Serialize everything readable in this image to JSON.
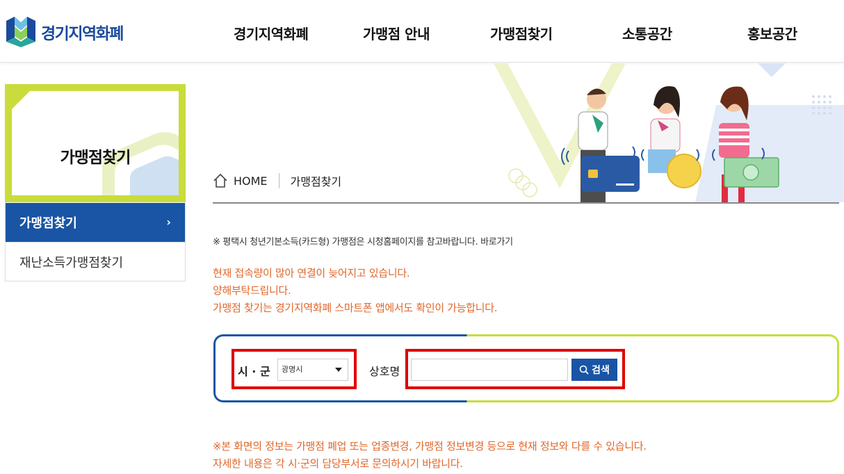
{
  "header": {
    "logo_text": "경기지역화폐",
    "nav": [
      "경기지역화폐",
      "가맹점 안내",
      "가맹점찾기",
      "소통공간",
      "홍보공간"
    ]
  },
  "sidebar": {
    "title": "가맹점찾기",
    "items": [
      {
        "label": "가맹점찾기",
        "active": true
      },
      {
        "label": "재난소득가맹점찾기",
        "active": false
      }
    ]
  },
  "breadcrumb": {
    "home": "HOME",
    "current": "가맹점찾기"
  },
  "notices": {
    "small": "※ 평택시 청년기본소득(카드형) 가맹점은 시청홈페이지를 참고바랍니다. 바로가기",
    "orange": [
      "현재 접속량이 많아 연결이 늦어지고 있습니다.",
      "양해부탁드립니다.",
      "가맹점 찾기는 경기지역화폐 스마트폰 앱에서도 확인이 가능합니다."
    ],
    "bottom": [
      "※본 화면의 정보는 가맹점 폐업 또는 업종변경, 가맹점 정보변경 등으로 현재 정보와 다를 수 있습니다.",
      "자세한 내용은 각 시·군의 담당부서로 문의하시기 바랍니다."
    ]
  },
  "search": {
    "sigun_label": "시 · 군",
    "sigun_value": "광명시",
    "name_label": "상호명",
    "name_value": "",
    "button_label": "검색"
  },
  "colors": {
    "brand_blue": "#1955a4",
    "accent_green": "#c9dc3c",
    "notice_orange": "#e0672a",
    "highlight_red": "#e00000"
  }
}
